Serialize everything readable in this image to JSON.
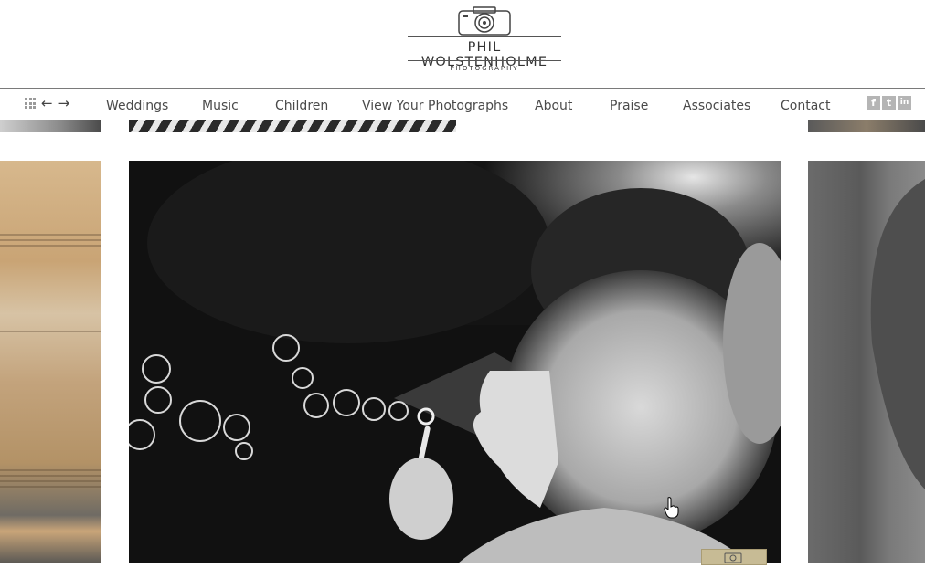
{
  "brand": {
    "name": "PHIL WOLSTENHOLME",
    "tagline": "PHOTOGRAPHY",
    "icon": "camera-icon"
  },
  "nav": {
    "controls": {
      "grid_icon": "grid-icon",
      "prev_icon": "arrow-left-icon",
      "next_icon": "arrow-right-icon",
      "prev_glyph": "←",
      "next_glyph": "→"
    },
    "items": [
      {
        "label": "Weddings"
      },
      {
        "label": "Music"
      },
      {
        "label": "Children"
      },
      {
        "label": "View Your Photographs"
      },
      {
        "label": "About"
      },
      {
        "label": "Praise"
      },
      {
        "label": "Associates"
      },
      {
        "label": "Contact"
      }
    ],
    "social": [
      {
        "icon": "facebook-icon",
        "glyph": "f"
      },
      {
        "icon": "twitter-icon",
        "glyph": "t"
      },
      {
        "icon": "linkedin-icon",
        "glyph": "in"
      }
    ]
  },
  "gallery": {
    "current_photo": "girl blowing bubbles (black and white)"
  },
  "colors": {
    "text": "#4a4a4a",
    "nav_border": "#7a7a7a",
    "social_icon_bg": "#b5b5b5"
  }
}
